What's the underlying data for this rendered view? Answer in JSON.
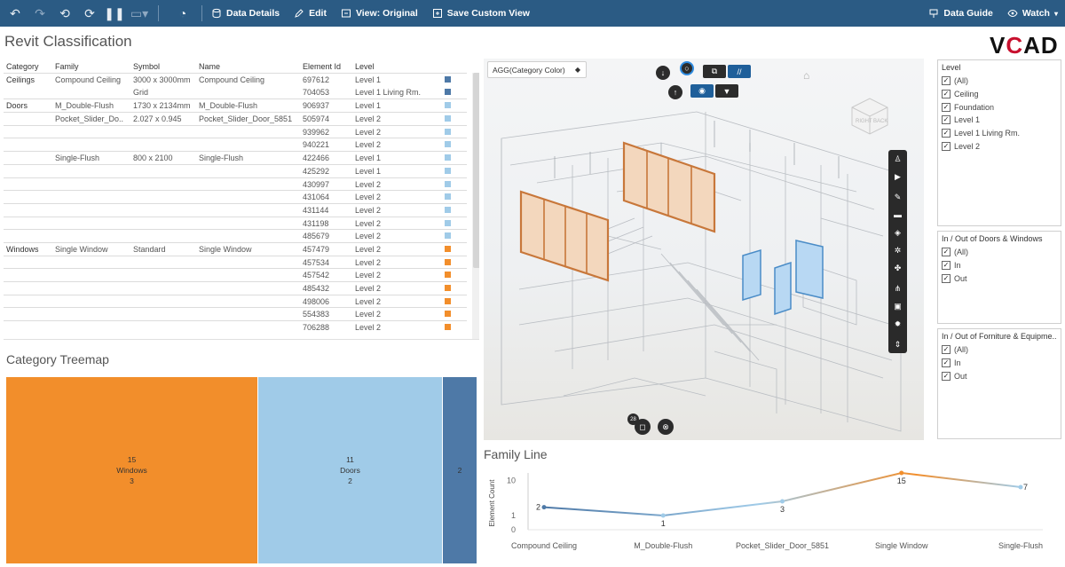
{
  "toolbar": {
    "buttons": [
      {
        "icon": "undo-icon"
      },
      {
        "icon": "redo-icon"
      },
      {
        "icon": "revert-icon"
      },
      {
        "icon": "refresh-icon"
      },
      {
        "icon": "pause-icon"
      },
      {
        "icon": "presentation-icon"
      },
      {
        "icon": "metrics-icon"
      }
    ],
    "data_details": "Data Details",
    "edit": "Edit",
    "view": "View: Original",
    "save_custom_view": "Save Custom View",
    "data_guide": "Data Guide",
    "watch": "Watch"
  },
  "page_title": "Revit Classification",
  "logo": {
    "prefix": "V",
    "accent": "C",
    "suffix": "AD"
  },
  "table": {
    "headers": [
      "Category",
      "Family",
      "Symbol",
      "Name",
      "Element Id",
      "Level"
    ],
    "rows": [
      {
        "category": "Ceilings",
        "family": "Compound Ceiling",
        "symbol": "3000 x 3000mm",
        "name": "Compound Ceiling",
        "id": "697612",
        "level": "Level 1",
        "color": "#4e79a7",
        "line": true
      },
      {
        "category": "",
        "family": "",
        "symbol": "Grid",
        "name": "",
        "id": "704053",
        "level": "Level 1 Living Rm.",
        "color": "#4e79a7",
        "line": false
      },
      {
        "category": "Doors",
        "family": "M_Double-Flush",
        "symbol": "1730 x 2134mm",
        "name": "M_Double-Flush",
        "id": "906937",
        "level": "Level 1",
        "color": "#a0cbe8",
        "line": true
      },
      {
        "category": "",
        "family": "Pocket_Slider_Do..",
        "symbol": "2.027 x 0.945",
        "name": "Pocket_Slider_Door_5851",
        "id": "505974",
        "level": "Level 2",
        "color": "#a0cbe8",
        "line": true
      },
      {
        "category": "",
        "family": "",
        "symbol": "",
        "name": "",
        "id": "939962",
        "level": "Level 2",
        "color": "#a0cbe8",
        "line": true
      },
      {
        "category": "",
        "family": "",
        "symbol": "",
        "name": "",
        "id": "940221",
        "level": "Level 2",
        "color": "#a0cbe8",
        "line": true
      },
      {
        "category": "",
        "family": "Single-Flush",
        "symbol": "800 x 2100",
        "name": "Single-Flush",
        "id": "422466",
        "level": "Level 1",
        "color": "#a0cbe8",
        "line": true
      },
      {
        "category": "",
        "family": "",
        "symbol": "",
        "name": "",
        "id": "425292",
        "level": "Level 1",
        "color": "#a0cbe8",
        "line": true
      },
      {
        "category": "",
        "family": "",
        "symbol": "",
        "name": "",
        "id": "430997",
        "level": "Level 2",
        "color": "#a0cbe8",
        "line": true
      },
      {
        "category": "",
        "family": "",
        "symbol": "",
        "name": "",
        "id": "431064",
        "level": "Level 2",
        "color": "#a0cbe8",
        "line": true
      },
      {
        "category": "",
        "family": "",
        "symbol": "",
        "name": "",
        "id": "431144",
        "level": "Level 2",
        "color": "#a0cbe8",
        "line": true
      },
      {
        "category": "",
        "family": "",
        "symbol": "",
        "name": "",
        "id": "431198",
        "level": "Level 2",
        "color": "#a0cbe8",
        "line": true
      },
      {
        "category": "",
        "family": "",
        "symbol": "",
        "name": "",
        "id": "485679",
        "level": "Level 2",
        "color": "#a0cbe8",
        "line": true
      },
      {
        "category": "Windows",
        "family": "Single Window",
        "symbol": "Standard",
        "name": "Single Window",
        "id": "457479",
        "level": "Level 2",
        "color": "#f28e2b",
        "line": true
      },
      {
        "category": "",
        "family": "",
        "symbol": "",
        "name": "",
        "id": "457534",
        "level": "Level 2",
        "color": "#f28e2b",
        "line": true
      },
      {
        "category": "",
        "family": "",
        "symbol": "",
        "name": "",
        "id": "457542",
        "level": "Level 2",
        "color": "#f28e2b",
        "line": true
      },
      {
        "category": "",
        "family": "",
        "symbol": "",
        "name": "",
        "id": "485432",
        "level": "Level 2",
        "color": "#f28e2b",
        "line": true
      },
      {
        "category": "",
        "family": "",
        "symbol": "",
        "name": "",
        "id": "498006",
        "level": "Level 2",
        "color": "#f28e2b",
        "line": true
      },
      {
        "category": "",
        "family": "",
        "symbol": "",
        "name": "",
        "id": "554383",
        "level": "Level 2",
        "color": "#f28e2b",
        "line": true
      },
      {
        "category": "",
        "family": "",
        "symbol": "",
        "name": "",
        "id": "706288",
        "level": "Level 2",
        "color": "#f28e2b",
        "line": true
      }
    ]
  },
  "treemap": {
    "title": "Category Treemap",
    "cells": [
      {
        "count": "15",
        "label": "Windows",
        "sub": "3",
        "value": 15,
        "color": "#f28e2b"
      },
      {
        "count": "11",
        "label": "Doors",
        "sub": "2",
        "value": 11,
        "color": "#a0cbe8"
      },
      {
        "count": "2",
        "label": "",
        "sub": "",
        "value": 2,
        "color": "#4e79a7"
      }
    ]
  },
  "viewer": {
    "select_label": "AGG(Category Color)",
    "badge": "28"
  },
  "filters": [
    {
      "title": "Level",
      "items": [
        "(All)",
        "Ceiling",
        "Foundation",
        "Level 1",
        "Level 1 Living Rm.",
        "Level 2"
      ]
    },
    {
      "title": "In / Out of Doors & Windows",
      "items": [
        "(All)",
        "In",
        "Out"
      ]
    },
    {
      "title": "In / Out of Forniture & Equipme..",
      "items": [
        "(All)",
        "In",
        "Out"
      ]
    }
  ],
  "chart_data": {
    "type": "line",
    "title": "Family Line",
    "xlabel": "",
    "ylabel": "Element Count",
    "categories": [
      "Compound Ceiling",
      "M_Double-Flush",
      "Pocket_Slider_Door_5851",
      "Single Window",
      "Single-Flush"
    ],
    "values": [
      2,
      1,
      3,
      15,
      7
    ],
    "yticks": [
      "0",
      "1",
      "10"
    ],
    "yscale": "log",
    "grid": false,
    "colors": {
      "low": "#4e79a7",
      "mid": "#a0cbe8",
      "high": "#f28e2b"
    }
  }
}
